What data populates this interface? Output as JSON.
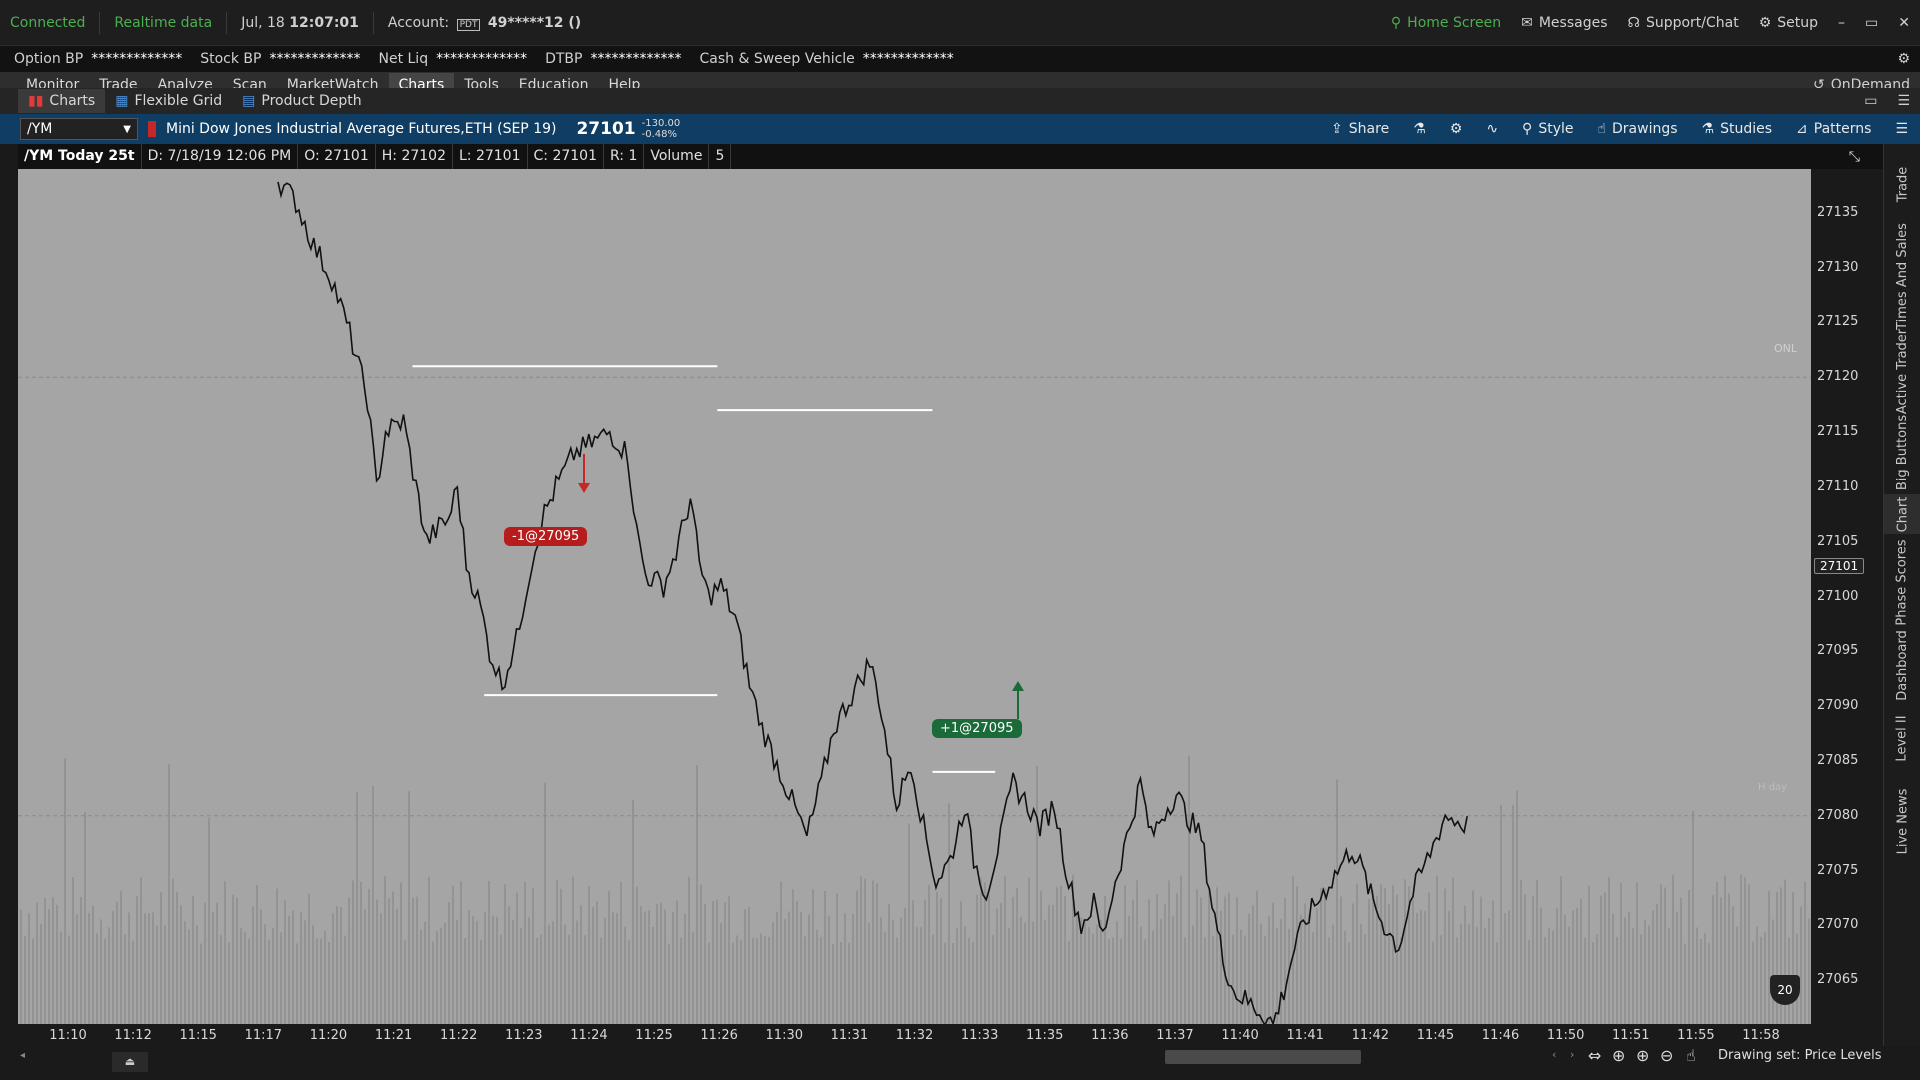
{
  "topbar": {
    "status": "Connected",
    "feed": "Realtime data",
    "date": "Jul, 18",
    "time": "12:07:01",
    "account_label": "Account:",
    "account_tag": "PDT",
    "account_number": "49*****12 ()",
    "home": "Home Screen",
    "messages": "Messages",
    "support": "Support/Chat",
    "setup": "Setup"
  },
  "bp_bar": [
    {
      "label": "Option BP",
      "value": "*************"
    },
    {
      "label": "Stock BP",
      "value": "*************"
    },
    {
      "label": "Net Liq",
      "value": "*************"
    },
    {
      "label": "DTBP",
      "value": "*************"
    },
    {
      "label": "Cash & Sweep Vehicle",
      "value": "*************"
    }
  ],
  "menu": [
    "Monitor",
    "Trade",
    "Analyze",
    "Scan",
    "MarketWatch",
    "Charts",
    "Tools",
    "Education",
    "Help"
  ],
  "menu_active": "Charts",
  "ondemand": "OnDemand",
  "subtabs": [
    "Charts",
    "Flexible Grid",
    "Product Depth"
  ],
  "symbol_bar": {
    "symbol": "/YM",
    "description": "Mini Dow Jones Industrial Average Futures,ETH (SEP 19)",
    "last": "27101",
    "change": "-130.00",
    "change_pct": "-0.48%",
    "tools": [
      "Share",
      "Style",
      "Drawings",
      "Studies",
      "Patterns"
    ]
  },
  "ohlc": [
    "/YM Today 25t",
    "D: 7/18/19 12:06 PM",
    "O: 27101",
    "H: 27102",
    "L: 27101",
    "C: 27101",
    "R: 1",
    "Volume",
    "5"
  ],
  "orders": {
    "sell": "-1@27095",
    "buy": "+1@27095"
  },
  "chart_labels": {
    "onl": "ONL",
    "hday": "H day",
    "bubble": "20",
    "last_price": "27101"
  },
  "side_tabs": [
    "Trade",
    "Times And Sales",
    "Active Trader",
    "Big Buttons",
    "Chart",
    "Phase Scores",
    "Dashboard",
    "Level II",
    "Live News"
  ],
  "drawing_set": "Drawing set: Price Levels",
  "chart_data": {
    "type": "line",
    "title": "/YM Today 25t",
    "ylim": [
      27061,
      27139
    ],
    "y_ticks": [
      27135,
      27130,
      27125,
      27120,
      27115,
      27110,
      27105,
      27100,
      27095,
      27090,
      27085,
      27080,
      27075,
      27070,
      27065
    ],
    "x_ticks": [
      "11:10",
      "11:12",
      "11:15",
      "11:17",
      "11:20",
      "11:21",
      "11:22",
      "11:23",
      "11:24",
      "11:25",
      "11:26",
      "11:30",
      "11:31",
      "11:32",
      "11:33",
      "11:35",
      "11:36",
      "11:37",
      "11:40",
      "11:41",
      "11:42",
      "11:45",
      "11:46",
      "11:50",
      "11:51",
      "11:55",
      "11:58"
    ],
    "price_path": [
      [
        0.145,
        27138
      ],
      [
        0.155,
        27136
      ],
      [
        0.165,
        27132
      ],
      [
        0.175,
        27129
      ],
      [
        0.185,
        27124
      ],
      [
        0.195,
        27118
      ],
      [
        0.2,
        27110
      ],
      [
        0.205,
        27115
      ],
      [
        0.215,
        27116
      ],
      [
        0.222,
        27110
      ],
      [
        0.228,
        27105
      ],
      [
        0.233,
        27106
      ],
      [
        0.24,
        27107
      ],
      [
        0.245,
        27110
      ],
      [
        0.25,
        27103
      ],
      [
        0.258,
        27099
      ],
      [
        0.263,
        27095
      ],
      [
        0.27,
        27092
      ],
      [
        0.278,
        27096
      ],
      [
        0.285,
        27102
      ],
      [
        0.292,
        27107
      ],
      [
        0.3,
        27110
      ],
      [
        0.31,
        27113
      ],
      [
        0.32,
        27114
      ],
      [
        0.33,
        27115
      ],
      [
        0.34,
        27113
      ],
      [
        0.345,
        27106
      ],
      [
        0.35,
        27102
      ],
      [
        0.36,
        27101
      ],
      [
        0.367,
        27104
      ],
      [
        0.375,
        27109
      ],
      [
        0.38,
        27103
      ],
      [
        0.385,
        27100
      ],
      [
        0.392,
        27101
      ],
      [
        0.4,
        27098
      ],
      [
        0.408,
        27092
      ],
      [
        0.415,
        27088
      ],
      [
        0.425,
        27084
      ],
      [
        0.435,
        27080
      ],
      [
        0.44,
        27078
      ],
      [
        0.448,
        27083
      ],
      [
        0.455,
        27088
      ],
      [
        0.465,
        27091
      ],
      [
        0.475,
        27094
      ],
      [
        0.48,
        27091
      ],
      [
        0.49,
        27081
      ],
      [
        0.498,
        27085
      ],
      [
        0.505,
        27079
      ],
      [
        0.512,
        27074
      ],
      [
        0.52,
        27076
      ],
      [
        0.528,
        27081
      ],
      [
        0.533,
        27076
      ],
      [
        0.54,
        27073
      ],
      [
        0.548,
        27078
      ],
      [
        0.555,
        27083
      ],
      [
        0.563,
        27081
      ],
      [
        0.57,
        27079
      ],
      [
        0.578,
        27081
      ],
      [
        0.586,
        27074
      ],
      [
        0.593,
        27070
      ],
      [
        0.6,
        27072
      ],
      [
        0.605,
        27069
      ],
      [
        0.612,
        27074
      ],
      [
        0.62,
        27079
      ],
      [
        0.626,
        27083
      ],
      [
        0.632,
        27078
      ],
      [
        0.638,
        27080
      ],
      [
        0.646,
        27082
      ],
      [
        0.652,
        27080
      ],
      [
        0.66,
        27078
      ],
      [
        0.666,
        27072
      ],
      [
        0.672,
        27067
      ],
      [
        0.678,
        27064
      ],
      [
        0.686,
        27063
      ],
      [
        0.694,
        27062
      ],
      [
        0.7,
        27061
      ],
      [
        0.706,
        27064
      ],
      [
        0.712,
        27068
      ],
      [
        0.72,
        27071
      ],
      [
        0.728,
        27073
      ],
      [
        0.736,
        27075
      ],
      [
        0.744,
        27077
      ],
      [
        0.75,
        27075
      ],
      [
        0.756,
        27072
      ],
      [
        0.762,
        27070
      ],
      [
        0.77,
        27068
      ],
      [
        0.778,
        27073
      ],
      [
        0.786,
        27076
      ],
      [
        0.796,
        27080
      ],
      [
        0.81,
        27079
      ]
    ],
    "levels": [
      {
        "price": 27121,
        "from": 0.22,
        "to": 0.39
      },
      {
        "price": 27117,
        "from": 0.39,
        "to": 0.51
      },
      {
        "price": 27091,
        "from": 0.26,
        "to": 0.39
      },
      {
        "price": 27084,
        "from": 0.51,
        "to": 0.545
      }
    ],
    "dashed_levels": [
      27120,
      27080
    ]
  }
}
